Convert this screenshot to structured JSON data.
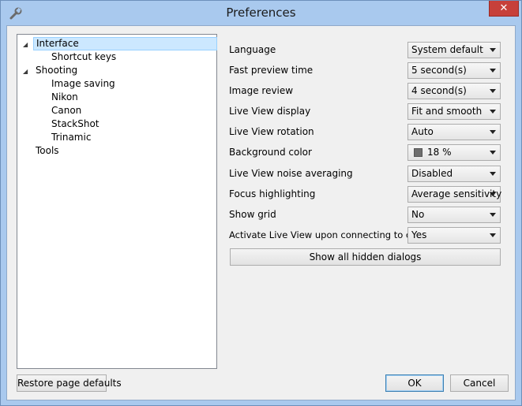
{
  "window": {
    "title": "Preferences",
    "close_glyph": "✕",
    "app_icon": "wrench-icon"
  },
  "tree": {
    "items": [
      {
        "label": "Interface",
        "expanded": true,
        "selected": true
      },
      {
        "label": "Shortcut keys"
      },
      {
        "label": "Shooting",
        "expanded": true
      },
      {
        "label": "Image saving"
      },
      {
        "label": "Nikon"
      },
      {
        "label": "Canon"
      },
      {
        "label": "StackShot"
      },
      {
        "label": "Trinamic"
      },
      {
        "label": "Tools"
      }
    ]
  },
  "settings": [
    {
      "label": "Language",
      "value": "System default"
    },
    {
      "label": "Fast preview time",
      "value": "5 second(s)"
    },
    {
      "label": "Image review",
      "value": "4 second(s)"
    },
    {
      "label": "Live View display",
      "value": "Fit and smooth"
    },
    {
      "label": "Live View rotation",
      "value": "Auto"
    },
    {
      "label": "Background color",
      "value": "18 %",
      "swatch_color": "#6e6e6e"
    },
    {
      "label": "Live View noise averaging",
      "value": "Disabled"
    },
    {
      "label": "Focus highlighting",
      "value": "Average sensitivity"
    },
    {
      "label": "Show grid",
      "value": "No"
    },
    {
      "label": "Activate Live View upon connecting to camera",
      "value": "Yes"
    }
  ],
  "buttons": {
    "show_hidden": "Show all hidden dialogs",
    "restore": "Restore page defaults",
    "ok": "OK",
    "cancel": "Cancel"
  }
}
